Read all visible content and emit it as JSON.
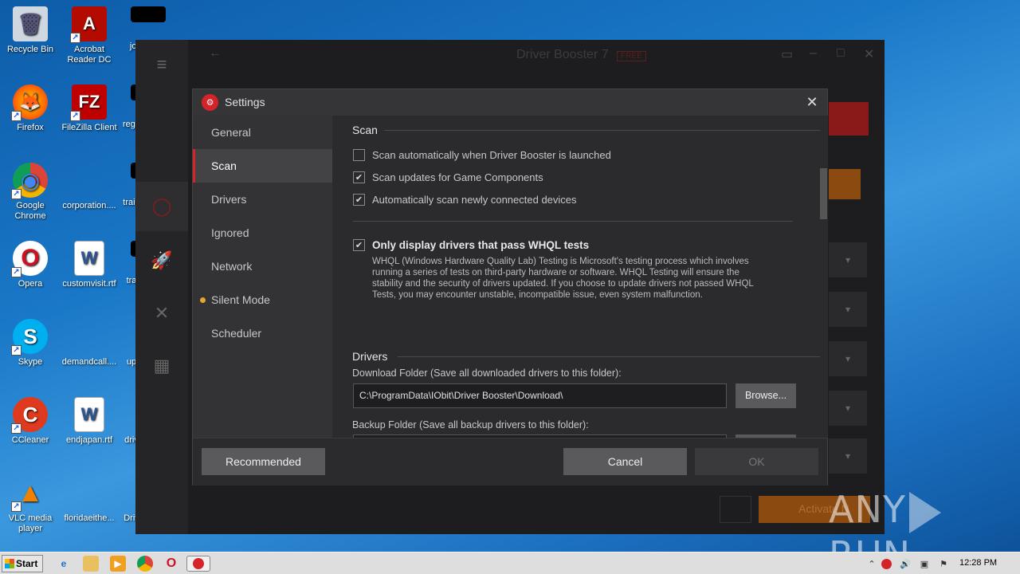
{
  "desktop": {
    "icons": [
      {
        "label": "Recycle Bin",
        "glyph": "🗑"
      },
      {
        "label": "Acrobat Reader DC",
        "glyph": "A"
      },
      {
        "label": "jobs",
        "glyph": ""
      },
      {
        "label": "Firefox",
        "glyph": "🦊"
      },
      {
        "label": "FileZilla Client",
        "glyph": "FZ"
      },
      {
        "label": "rega",
        "glyph": ""
      },
      {
        "label": "Google Chrome",
        "glyph": "◉"
      },
      {
        "label": "corporation....",
        "glyph": ""
      },
      {
        "label": "train",
        "glyph": ""
      },
      {
        "label": "Opera",
        "glyph": "O"
      },
      {
        "label": "customvisit.rtf",
        "glyph": "W"
      },
      {
        "label": "tra",
        "glyph": ""
      },
      {
        "label": "Skype",
        "glyph": "S"
      },
      {
        "label": "demandcall....",
        "glyph": ""
      },
      {
        "label": "up",
        "glyph": ""
      },
      {
        "label": "CCleaner",
        "glyph": "C"
      },
      {
        "label": "endjapan.rtf",
        "glyph": "W"
      },
      {
        "label": "driv",
        "glyph": ""
      },
      {
        "label": "VLC media player",
        "glyph": "▲"
      },
      {
        "label": "floridaeithe...",
        "glyph": ""
      },
      {
        "label": "Driv",
        "glyph": ""
      }
    ]
  },
  "background_app": {
    "title": "Driver Booster 7",
    "badge": "FREE",
    "activate_label": "Activate N"
  },
  "dialog": {
    "title": "Settings",
    "nav": [
      {
        "label": "General"
      },
      {
        "label": "Scan"
      },
      {
        "label": "Drivers"
      },
      {
        "label": "Ignored"
      },
      {
        "label": "Network"
      },
      {
        "label": "Silent Mode"
      },
      {
        "label": "Scheduler"
      }
    ],
    "scan": {
      "heading": "Scan",
      "options": [
        {
          "label": "Scan automatically when Driver Booster is launched",
          "checked": false
        },
        {
          "label": "Scan updates for Game Components",
          "checked": true
        },
        {
          "label": "Automatically scan newly connected devices",
          "checked": true
        }
      ],
      "whql_title": "Only display drivers that pass WHQL tests",
      "whql_checked": true,
      "whql_desc": "WHQL (Windows Hardware Quality Lab) Testing is Microsoft's testing process which involves running a series of tests on third-party hardware or software. WHQL Testing will ensure the stability and the security of drivers updated. If you choose to update drivers not passed WHQL Tests, you may encounter unstable, incompatible issue, even system malfunction."
    },
    "drivers": {
      "heading": "Drivers",
      "download_label": "Download Folder (Save all downloaded drivers to this folder):",
      "download_path": "C:\\ProgramData\\IObit\\Driver Booster\\Download\\",
      "browse_label": "Browse...",
      "backup_label": "Backup Folder (Save all backup drivers to this folder):"
    },
    "footer": {
      "recommended": "Recommended",
      "cancel": "Cancel",
      "ok": "OK"
    }
  },
  "watermark": {
    "left": "ANY",
    "right": "RUN"
  },
  "taskbar": {
    "start": "Start",
    "clock": "12:28 PM"
  }
}
